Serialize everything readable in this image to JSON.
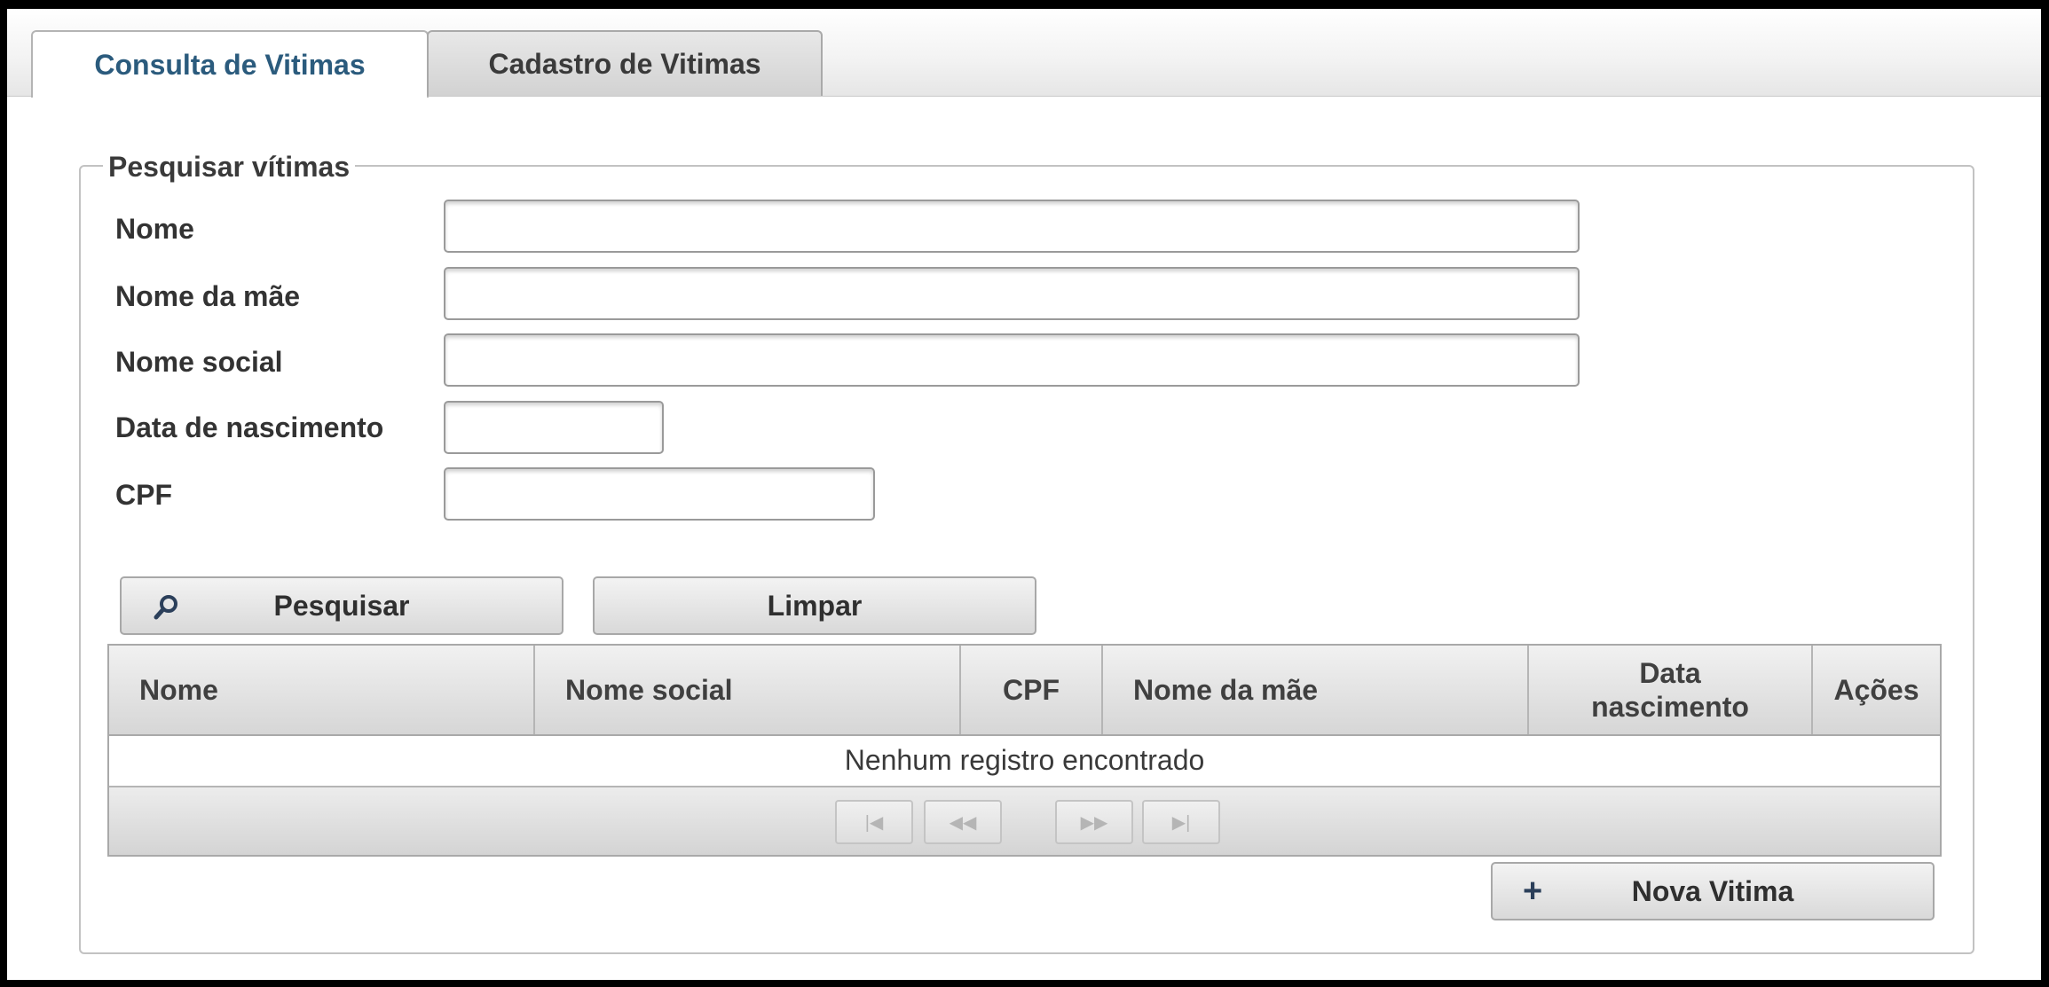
{
  "tabs": {
    "consulta": "Consulta de Vitimas",
    "cadastro": "Cadastro de Vitimas"
  },
  "search": {
    "legend": "Pesquisar vítimas",
    "fields": {
      "nome": {
        "label": "Nome",
        "value": ""
      },
      "nome_mae": {
        "label": "Nome da mãe",
        "value": ""
      },
      "nome_social": {
        "label": "Nome social",
        "value": ""
      },
      "data_nascimento": {
        "label": "Data de nascimento",
        "value": ""
      },
      "cpf": {
        "label": "CPF",
        "value": ""
      }
    },
    "buttons": {
      "search": "Pesquisar",
      "clear": "Limpar"
    }
  },
  "results": {
    "columns": {
      "nome": "Nome",
      "nome_social": "Nome social",
      "cpf": "CPF",
      "nome_mae": "Nome da mãe",
      "data_nascimento_1": "Data",
      "data_nascimento_2": "nascimento",
      "acoes": "Ações"
    },
    "empty_message": "Nenhum registro encontrado",
    "pager": {
      "first": "|◀",
      "prev": "◀◀",
      "next": "▶▶",
      "last": "▶|"
    }
  },
  "actions": {
    "new_plus": "+",
    "new_label": "Nova Vitima"
  },
  "icons": {
    "search": "magnifier-icon",
    "add": "plus-icon"
  }
}
